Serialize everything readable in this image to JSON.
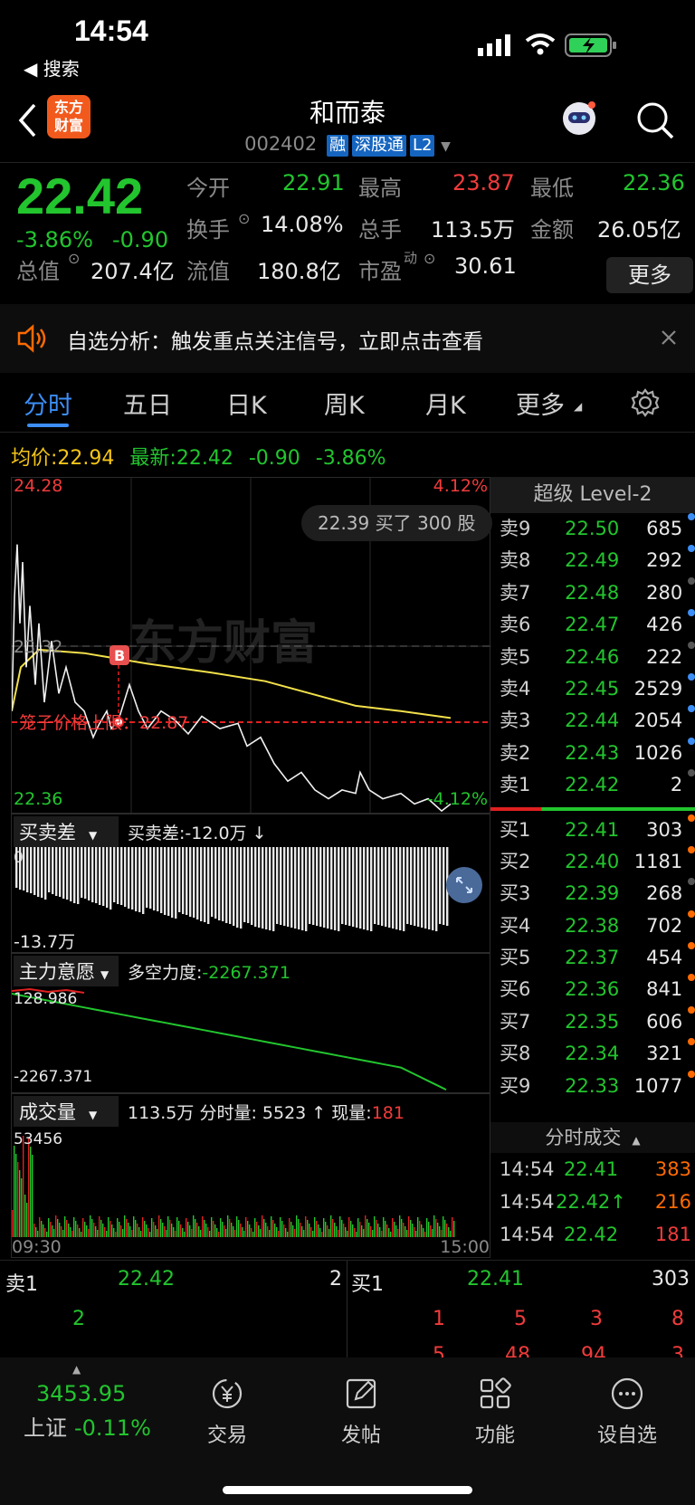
{
  "status": {
    "time": "14:54",
    "back_app": "◀ 搜索"
  },
  "nav": {
    "title": "和而泰",
    "code": "002402",
    "tags": [
      "融",
      "深股通",
      "L2"
    ],
    "logo_lines": [
      "东方",
      "财富"
    ]
  },
  "quote": {
    "price": "22.42",
    "change_pct": "-3.86%",
    "change": "-0.90",
    "fields": [
      {
        "label": "今开",
        "value": "22.91",
        "color": "g"
      },
      {
        "label": "最高",
        "value": "23.87",
        "color": "r"
      },
      {
        "label": "最低",
        "value": "22.36",
        "color": "g"
      },
      {
        "label": "换手",
        "value": "14.08%",
        "color": "w"
      },
      {
        "label": "总手",
        "value": "113.5万",
        "color": "w"
      },
      {
        "label": "金额",
        "value": "26.05亿",
        "color": "w"
      },
      {
        "label": "总值",
        "value": "207.4亿",
        "color": "w"
      },
      {
        "label": "流值",
        "value": "180.8亿",
        "color": "w"
      },
      {
        "label": "市盈",
        "value": "30.61",
        "color": "w"
      }
    ],
    "pe_sup": "动",
    "more": "更多"
  },
  "alert": {
    "text": "自选分析：触发重点关注信号，立即点击查看"
  },
  "tabs": [
    "分时",
    "五日",
    "日K",
    "周K",
    "月K",
    "更多"
  ],
  "avgline": {
    "avg_label": "均价:",
    "avg": "22.94",
    "last_label": "最新:",
    "last": "22.42",
    "chg": "-0.90",
    "pct": "-3.86%"
  },
  "chart": {
    "ymax": "24.28",
    "ymax_pct": "4.12%",
    "ymin": "22.36",
    "ymin_pct": "-4.12%",
    "mid": "23.32",
    "trade_bubble": "22.39 买了 300 股",
    "cage": "笼子价格上限：22.87",
    "marker": "B",
    "watermark": "东方财富"
  },
  "diff": {
    "tab": "买卖差",
    "text": "买卖差:-12.0万 ↓",
    "top": "0",
    "bottom": "-13.7万"
  },
  "main": {
    "tab": "主力意愿",
    "label": "多空力度:",
    "value": "-2267.371",
    "top": "128.986",
    "bottom": "-2267.371"
  },
  "vol": {
    "tab": "成交量",
    "total": "113.5万",
    "mlabel": "分时量:",
    "mval": "5523 ↑",
    "nlabel": "现量:",
    "nval": "181",
    "max": "53456",
    "start": "09:30",
    "end": "15:00"
  },
  "orderbook": {
    "title": "超级 Level-2",
    "asks": [
      {
        "l": "卖9",
        "p": "22.50",
        "v": "685",
        "c": "#3d8ef7"
      },
      {
        "l": "卖8",
        "p": "22.49",
        "v": "292",
        "c": "#3d8ef7"
      },
      {
        "l": "卖7",
        "p": "22.48",
        "v": "280",
        "c": "#555"
      },
      {
        "l": "卖6",
        "p": "22.47",
        "v": "426",
        "c": "#3d8ef7"
      },
      {
        "l": "卖5",
        "p": "22.46",
        "v": "222",
        "c": "#555"
      },
      {
        "l": "卖4",
        "p": "22.45",
        "v": "2529",
        "c": "#3d8ef7"
      },
      {
        "l": "卖3",
        "p": "22.44",
        "v": "2054",
        "c": "#3d8ef7"
      },
      {
        "l": "卖2",
        "p": "22.43",
        "v": "1026",
        "c": "#3d8ef7"
      },
      {
        "l": "卖1",
        "p": "22.42",
        "v": "2",
        "c": "#555"
      }
    ],
    "bids": [
      {
        "l": "买1",
        "p": "22.41",
        "v": "303",
        "c": "#ff6a00"
      },
      {
        "l": "买2",
        "p": "22.40",
        "v": "1181",
        "c": "#ff6a00"
      },
      {
        "l": "买3",
        "p": "22.39",
        "v": "268",
        "c": "#555"
      },
      {
        "l": "买4",
        "p": "22.38",
        "v": "702",
        "c": "#ff6a00"
      },
      {
        "l": "买5",
        "p": "22.37",
        "v": "454",
        "c": "#ff6a00"
      },
      {
        "l": "买6",
        "p": "22.36",
        "v": "841",
        "c": "#ff6a00"
      },
      {
        "l": "买7",
        "p": "22.35",
        "v": "606",
        "c": "#ff6a00"
      },
      {
        "l": "买8",
        "p": "22.34",
        "v": "321",
        "c": "#ff6a00"
      },
      {
        "l": "买9",
        "p": "22.33",
        "v": "1077",
        "c": "#ff6a00"
      }
    ],
    "ticks_title": "分时成交",
    "ticks": [
      {
        "t": "14:54",
        "p": "22.41",
        "v": "383",
        "vc": "o"
      },
      {
        "t": "14:54",
        "p": "22.42↑",
        "v": "216",
        "vc": "o"
      },
      {
        "t": "14:54",
        "p": "22.42",
        "v": "181",
        "vc": "r"
      }
    ]
  },
  "queue": {
    "sell_label": "卖1",
    "sell_price": "22.42",
    "sell_vol": "2",
    "sell_items": [
      "2"
    ],
    "buy_label": "买1",
    "buy_price": "22.41",
    "buy_vol": "303",
    "buy_items": [
      "1",
      "5",
      "3",
      "8",
      "5",
      "48",
      "94",
      "3"
    ]
  },
  "bottom": {
    "index_value": "3453.95",
    "index_name": "上证",
    "index_pct": "-0.11%",
    "items": [
      "交易",
      "发帖",
      "功能",
      "设自选"
    ]
  }
}
